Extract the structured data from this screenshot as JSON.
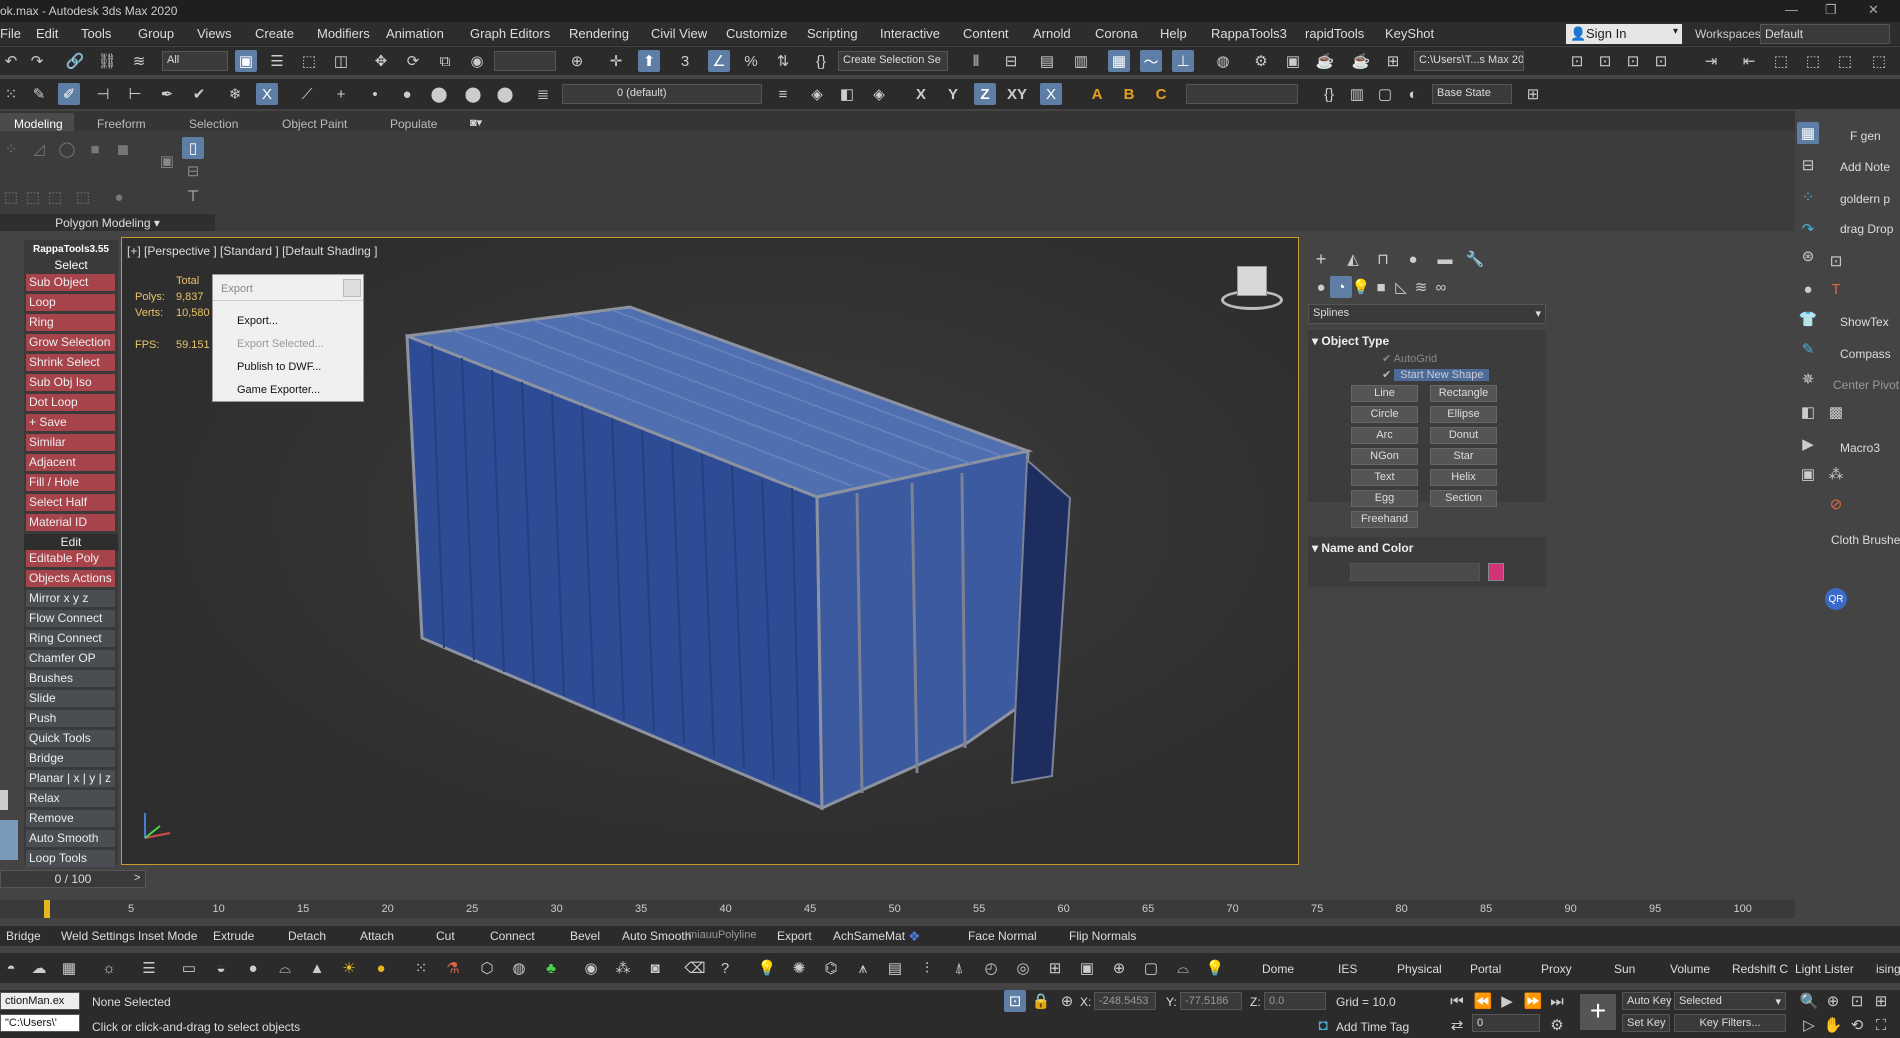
{
  "title": "ok.max - Autodesk 3ds Max 2020",
  "menus": [
    "File",
    "Edit",
    "Tools",
    "Group",
    "Views",
    "Create",
    "Modifiers",
    "Animation",
    "Graph Editors",
    "Rendering",
    "Civil View",
    "Customize",
    "Scripting",
    "Interactive",
    "Content",
    "Arnold",
    "Corona",
    "Help",
    "RappaTools3",
    "rapidTools",
    "KeyShot"
  ],
  "menus_x": [
    0,
    36,
    81,
    138,
    197,
    255,
    317,
    386,
    470,
    569,
    651,
    726,
    807,
    880,
    963,
    1033,
    1095,
    1160,
    1211,
    1305,
    1385
  ],
  "signin": "Sign In",
  "workspaces_label": "Workspaces:",
  "workspaces_value": "Default",
  "toolbar": {
    "filter": "All",
    "selection_set": "Create Selection Se",
    "path": "C:\\Users\\T...s Max 2020",
    "layer": "0 (default)",
    "base_state": "Base State"
  },
  "ribbon_tabs": [
    "Modeling",
    "Freeform",
    "Selection",
    "Object Paint",
    "Populate"
  ],
  "ribbon_tabs_x": [
    14,
    97,
    189,
    282,
    390
  ],
  "polygon_modeling": "Polygon Modeling",
  "viewport": {
    "label": "[+] [Perspective ] [Standard ] [Default Shading ]",
    "stats": {
      "total": "Total",
      "polys_label": "Polys:",
      "polys": "9,837",
      "verts_label": "Verts:",
      "verts": "10,580",
      "fps_label": "FPS:",
      "fps": "59.151"
    }
  },
  "export_menu": {
    "title": "Export",
    "items": [
      {
        "label": "Export...",
        "disabled": false
      },
      {
        "label": "Export Selected...",
        "disabled": true
      },
      {
        "label": "Publish to DWF...",
        "disabled": false
      },
      {
        "label": "Game Exporter...",
        "disabled": false
      }
    ]
  },
  "rappa": {
    "title": "RappaTools3.55",
    "select": "Select",
    "items": [
      "Sub Object",
      "Loop",
      "Ring",
      "Grow Selection",
      "Shrink Select",
      "Sub Obj Iso",
      "Dot Loop",
      "+ Save",
      "Similar",
      "Adjacent",
      "Fill / Hole",
      "Select Half",
      "Material ID"
    ],
    "edit": "Edit",
    "edit_items": [
      "Editable Poly",
      "Objects Actions",
      "Mirror  x  y  z",
      "Flow Connect",
      "Ring Connect",
      "Chamfer OP",
      "Brushes",
      "Slide",
      "Push",
      "Quick Tools",
      "Bridge",
      "Planar | x | y | z",
      "Relax",
      "Remove",
      "Auto Smooth",
      "Loop Tools"
    ]
  },
  "command_panel": {
    "category": "Splines",
    "object_type": "Object Type",
    "autogrid": "AutoGrid",
    "start_new_shape": "Start New Shape",
    "buttons": [
      "Line",
      "Rectangle",
      "Circle",
      "Ellipse",
      "Arc",
      "Donut",
      "NGon",
      "Star",
      "Text",
      "Helix",
      "Egg",
      "Section",
      "Freehand"
    ],
    "name_and_color": "Name and Color",
    "swatch": "#d0357a"
  },
  "right_panel": [
    "F gen",
    "Add Note",
    "goldern p",
    "drag Drop",
    "ShowTex",
    "Compass",
    "Center Pivot",
    "Macro3",
    "Cloth Brushes"
  ],
  "time_slider": "0 / 100",
  "timeline_ticks": [
    "5",
    "10",
    "15",
    "20",
    "25",
    "30",
    "35",
    "40",
    "45",
    "50",
    "55",
    "60",
    "65",
    "70",
    "75",
    "80",
    "85",
    "90",
    "95",
    "100"
  ],
  "bottom_macros": [
    "Bridge",
    "Weld Settings",
    "Inset Mode",
    "Extrude",
    "Detach",
    "Attach",
    "Cut",
    "Connect",
    "Bevel",
    "Auto Smooth",
    "miauuPolyline",
    "Export",
    "AchSameMat",
    "Face Normal",
    "Flip Normals"
  ],
  "create_labels": [
    "Dome",
    "IES",
    "Physical",
    "Portal",
    "Proxy",
    "Sun",
    "Volume",
    "Redshift C",
    "Light Lister",
    "ising:"
  ],
  "status": {
    "script1": "ctionMan.ex",
    "script2": "\"C:\\Users\\'",
    "none_selected": "None Selected",
    "hint": "Click or click-and-drag to select objects",
    "x_label": "X:",
    "x": "-248.5453",
    "y_label": "Y:",
    "y": "-77.5186",
    "z_label": "Z:",
    "z": "0.0",
    "grid": "Grid = 10.0",
    "add_time_tag": "Add Time Tag",
    "auto_key": "Auto Key",
    "set_key": "Set Key",
    "selected": "Selected",
    "key_filters": "Key Filters...",
    "frame": "0"
  }
}
